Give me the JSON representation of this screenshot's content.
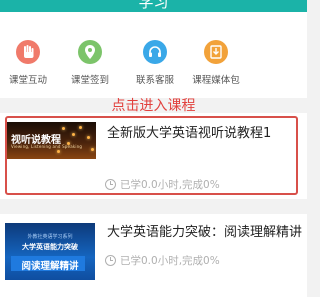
{
  "header": {
    "title": "学习"
  },
  "shortcuts": [
    {
      "label": "课堂互动",
      "icon": "hand-icon",
      "color": "#f07a6a"
    },
    {
      "label": "课堂签到",
      "icon": "location-pin-icon",
      "color": "#7cc46a"
    },
    {
      "label": "联系客服",
      "icon": "headset-icon",
      "color": "#3aa8e8"
    },
    {
      "label": "课程媒体包",
      "icon": "download-icon",
      "color": "#f2a23a"
    }
  ],
  "hint": "点击进入课程",
  "courses": [
    {
      "title": "全新版大学英语视听说教程1",
      "progress": "已学0.0小时,完成0%",
      "thumbnail": {
        "title": "视听说教程",
        "subtitle": "Viewing, Listening and Speaking"
      }
    },
    {
      "title": "大学英语能力突破：阅读理解精讲",
      "progress": "已学0.0小时,完成0%",
      "thumbnail": {
        "top": "外教社英语学习系列",
        "mid": "大学英语能力突破",
        "bottom": "阅读理解精讲"
      }
    }
  ],
  "colors": {
    "accent": "#1bb3a8",
    "highlight": "#d8504a",
    "hint": "#e2413e"
  }
}
